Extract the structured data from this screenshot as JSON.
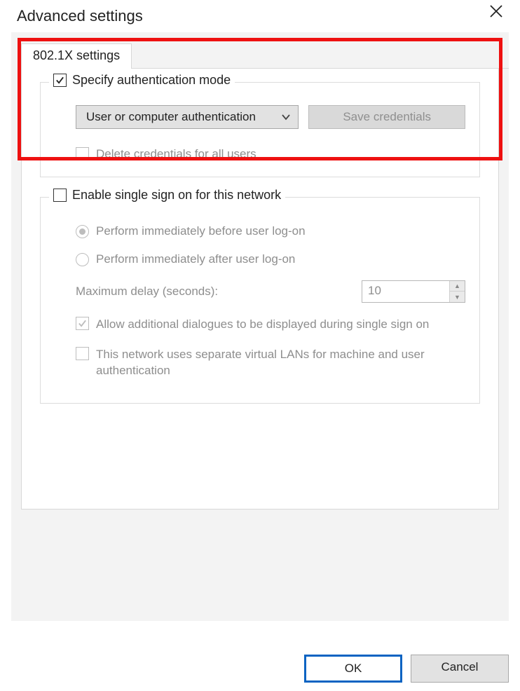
{
  "window": {
    "title": "Advanced settings"
  },
  "tab": {
    "label": "802.1X settings"
  },
  "auth_mode": {
    "legend": "Specify authentication mode",
    "checked": true,
    "dropdown_value": "User or computer authentication",
    "save_btn": "Save credentials",
    "delete_label": "Delete credentials for all users"
  },
  "sso": {
    "legend": "Enable single sign on for this network",
    "checked": false,
    "radio_before": "Perform immediately before user log-on",
    "radio_after": "Perform immediately after user log-on",
    "max_delay_label": "Maximum delay (seconds):",
    "max_delay_value": "10",
    "allow_dialogs": "Allow additional dialogues to be displayed during single sign on",
    "separate_vlan": "This network uses separate virtual LANs for machine and user authentication"
  },
  "footer": {
    "ok": "OK",
    "cancel": "Cancel"
  }
}
